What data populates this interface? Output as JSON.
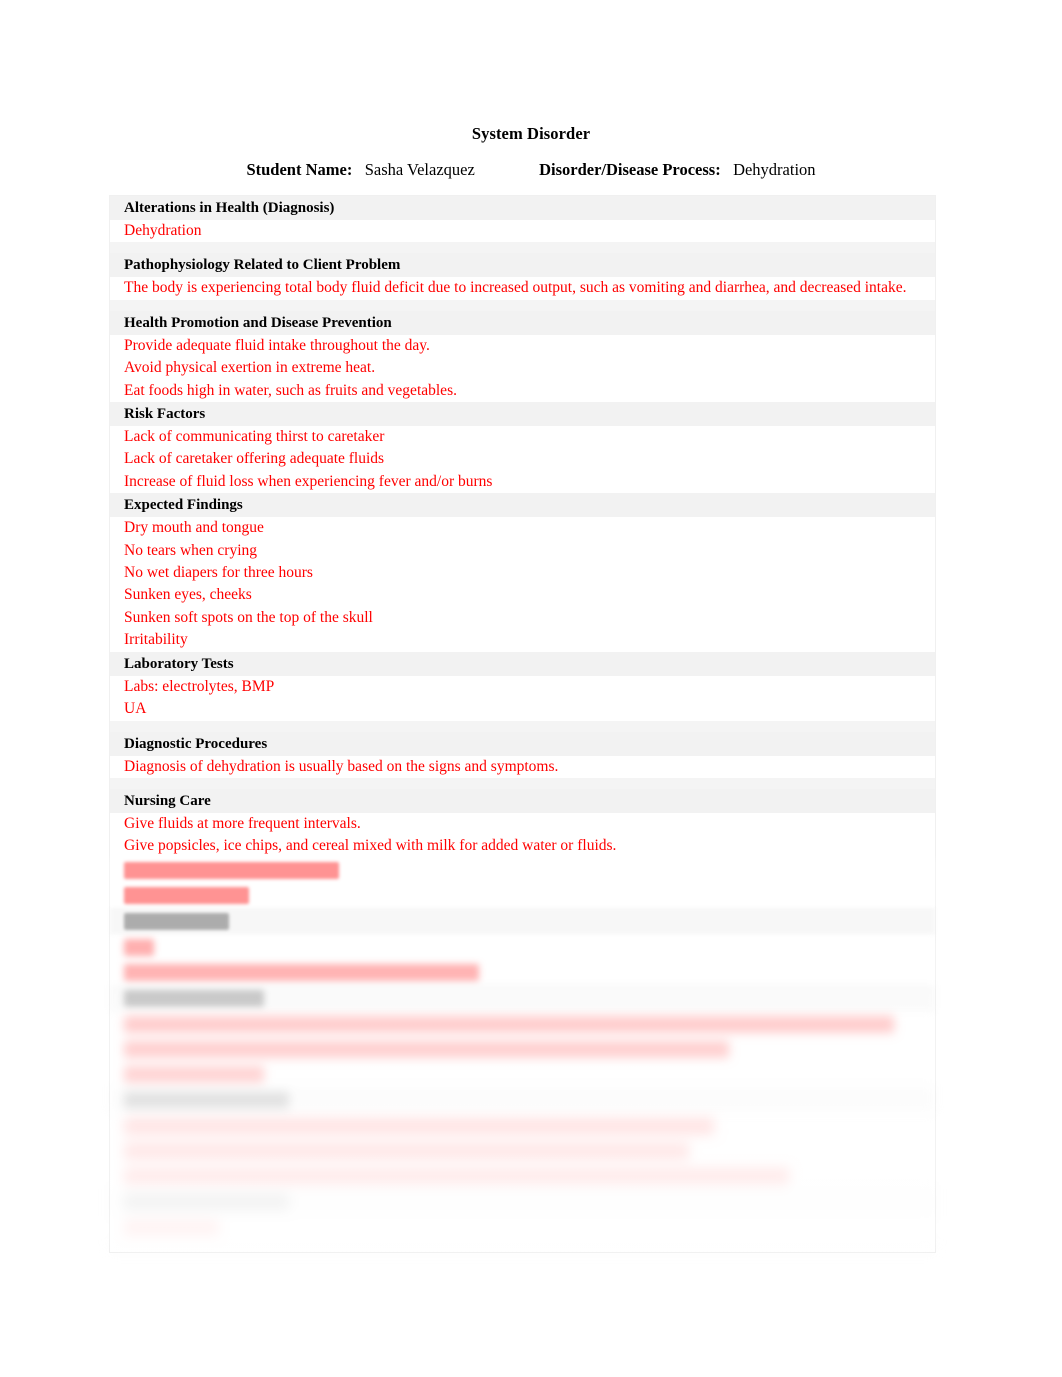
{
  "document": {
    "title": "System Disorder",
    "student_name_label": "Student Name:",
    "student_name_value": "Sasha Velazquez",
    "disorder_label": "Disorder/Disease Process:",
    "disorder_value": "Dehydration",
    "content_color": "#ff0000",
    "heading_color": "#000000",
    "heading_band_color": "#f2f2f2"
  },
  "sections": [
    {
      "heading": "Alterations in Health (Diagnosis)",
      "lines": [
        "Dehydration"
      ]
    },
    {
      "heading": "Pathophysiology Related to Client Problem",
      "lines": [
        "The body is experiencing total body fluid deficit due to increased output, such as vomiting and diarrhea, and decreased intake."
      ]
    },
    {
      "heading": "Health Promotion and Disease Prevention",
      "lines": [
        "Provide adequate fluid intake throughout the day.",
        "Avoid physical exertion in extreme heat.",
        "Eat foods high in water, such as fruits and vegetables."
      ]
    },
    {
      "heading": "Risk Factors",
      "lines": [
        "Lack of communicating thirst to caretaker",
        "Lack of caretaker offering adequate fluids",
        "Increase of fluid loss when experiencing fever and/or burns"
      ]
    },
    {
      "heading": "Expected Findings",
      "lines": [
        "Dry mouth and tongue",
        "No tears when crying",
        "No wet diapers for three hours",
        "Sunken eyes, cheeks",
        "Sunken soft spots on the top of the skull",
        "Irritability"
      ]
    },
    {
      "heading": "Laboratory Tests",
      "lines": [
        "Labs: electrolytes, BMP",
        "UA"
      ]
    },
    {
      "heading": "Diagnostic Procedures",
      "lines": [
        "Diagnosis of dehydration is usually based on the signs and symptoms."
      ]
    },
    {
      "heading": "Nursing Care",
      "lines": [
        "Give fluids at more frequent intervals.",
        "Give popsicles, ice chips, and cereal mixed with milk for added water or fluids."
      ]
    }
  ],
  "obscured_note": "Lower portion of the form is blurred and faded beyond legibility."
}
